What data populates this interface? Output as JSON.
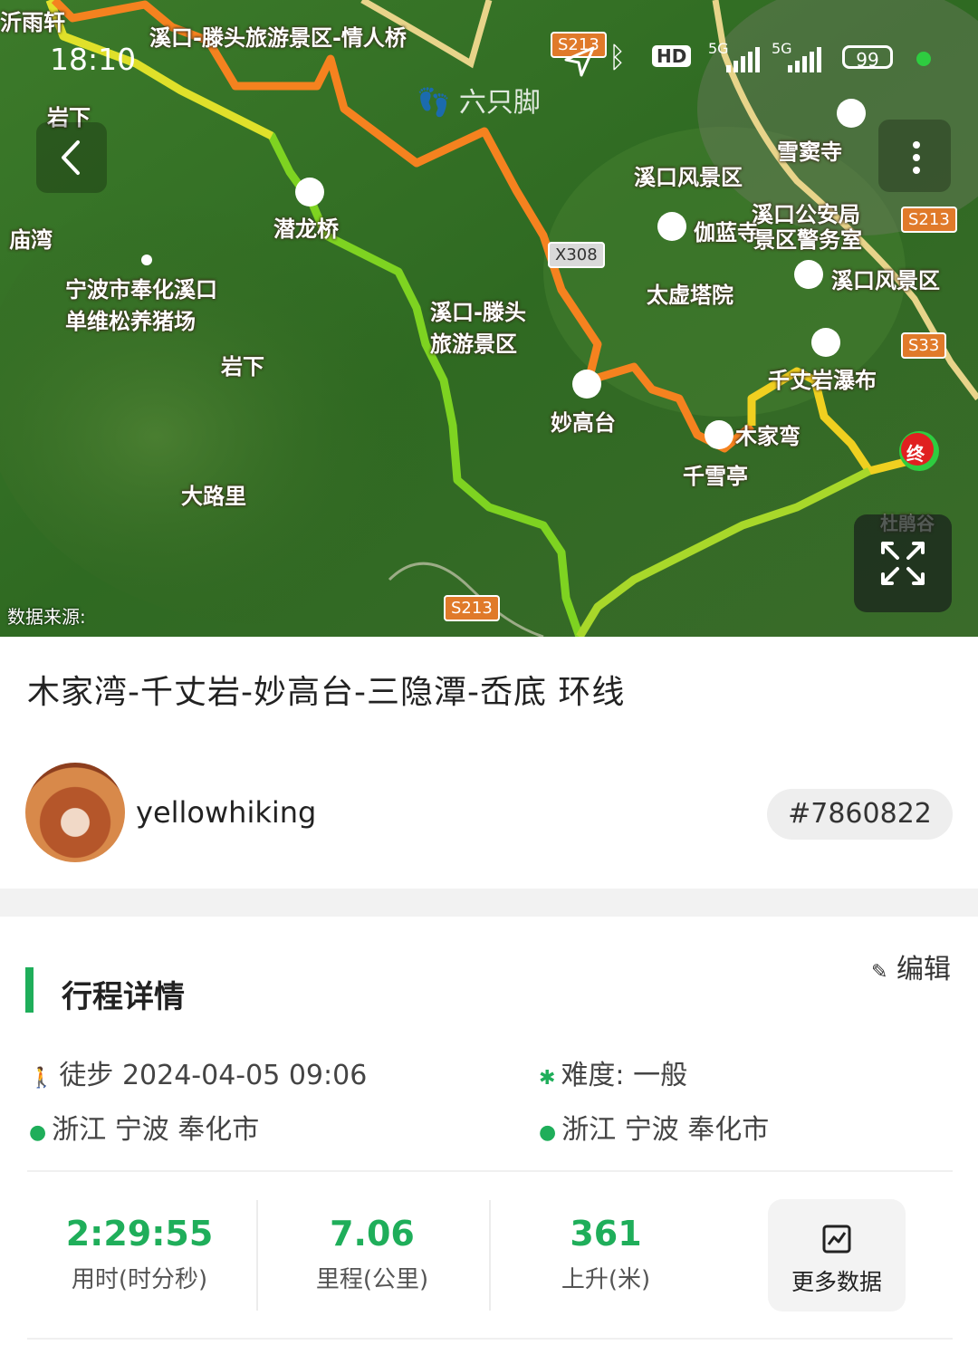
{
  "status_bar": {
    "time": "18:10",
    "network_1": "5G",
    "network_2": "5G",
    "hd": "HD",
    "battery": "99"
  },
  "map": {
    "brand": "六只脚",
    "data_source": "数据来源:",
    "labels": [
      "溪口-滕头旅游景区-情人桥",
      "岩下",
      "庙湾",
      "潜龙桥",
      "宁波市奉化溪口单维松养猪场",
      "岩下",
      "大路里",
      "溪口-滕头旅游景区",
      "溪口风景区",
      "溪口公安局",
      "伽蓝寺",
      "景区警务室",
      "雪窦寺",
      "太虚塔院",
      "溪口风景区",
      "妙高台",
      "千丈岩瀑布",
      "木家弯",
      "千雪亭",
      "沂雨轩",
      "杜鹃谷"
    ],
    "road_tags": [
      "S213",
      "X308",
      "S213",
      "S33",
      "S213"
    ],
    "end_marker": "终"
  },
  "route": {
    "title": "木家湾-千丈岩-妙高台-三隐潭-岙底 环线",
    "author": "yellowhiking",
    "id": "#7860822"
  },
  "details": {
    "section_title": "行程详情",
    "edit_label": "编辑",
    "activity": "徒步 2024-04-05 09:06",
    "difficulty": "难度: 一般",
    "start_location": "浙江 宁波 奉化市",
    "end_location": "浙江 宁波 奉化市"
  },
  "stats": [
    {
      "value": "2:29:55",
      "label": "用时(时分秒)"
    },
    {
      "value": "7.06",
      "label": "里程(公里)"
    },
    {
      "value": "361",
      "label": "上升(米)"
    }
  ],
  "more_data_label": "更多数据",
  "colors": {
    "accent": "#1fae5a",
    "route_fast": "#7ed321",
    "route_slow": "#f5821f"
  }
}
